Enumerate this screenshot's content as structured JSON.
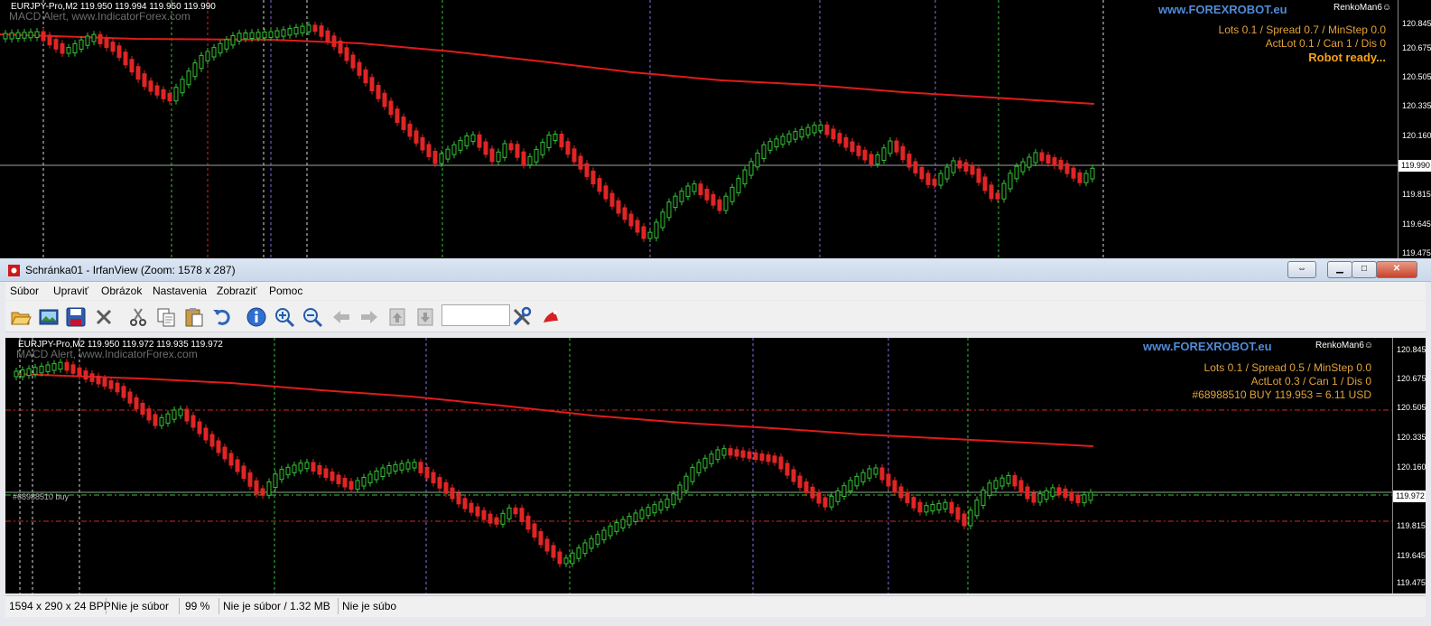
{
  "background_chart": {
    "symbol": "EURJPY-Pro,M2  119.950 119.994 119.950 119.990",
    "watermark": "MACD Alert, www.IndicatorForex.com",
    "brand": "www.FOREXROBOT.eu",
    "ea_name": "RenkoMan6☺",
    "info_line1": "Lots 0.1 / Spread 0.7 / MinStep 0.0",
    "info_line2": "ActLot 0.1 / Can 1 / Dis 0",
    "status": "Robot ready...",
    "price_ticks": [
      "120.845",
      "120.675",
      "120.505",
      "120.335",
      "120.160",
      "119.990",
      "119.815",
      "119.645",
      "119.475"
    ],
    "current_price": "119.990"
  },
  "window": {
    "title": "Schránka01 - IrfanView (Zoom: 1578 x 287)",
    "menu": [
      "Súbor",
      "Upraviť",
      "Obrázok",
      "Nastavenia",
      "Zobraziť",
      "Pomoc"
    ],
    "toolbar_icons": [
      "open-icon",
      "thumbnails-icon",
      "save-icon",
      "delete-icon",
      "cut-icon",
      "copy-icon",
      "paste-icon",
      "undo-icon",
      "info-icon",
      "zoom-in-icon",
      "zoom-out-icon",
      "previous-icon",
      "next-icon",
      "page-up-icon",
      "page-down-icon",
      "settings-icon",
      "irfanview-icon"
    ],
    "zoom_input": "",
    "status_bar": [
      "1594 x 290 x 24 BPP",
      "Nie je súbor",
      "99 %",
      "Nie je súbor / 1.32 MB",
      "Nie je súbo"
    ]
  },
  "inner_chart": {
    "symbol": "EURJPY-Pro,M2  119.950 119.972 119.935 119.972",
    "watermark": "MACD Alert, www.IndicatorForex.com",
    "brand": "www.FOREXROBOT.eu",
    "ea_name": "RenkoMan6☺",
    "info_line1": "Lots 0.1 / Spread 0.5 / MinStep 0.0",
    "info_line2": "ActLot 0.3 / Can 1 / Dis 0",
    "info_line3": "#68988510 BUY 119.953 = 6.11 USD",
    "order_label": "#68988510 buy",
    "price_ticks": [
      "120.845",
      "120.675",
      "120.505",
      "120.335",
      "120.160",
      "119.972",
      "119.815",
      "119.645",
      "119.475"
    ],
    "current_price": "119.972"
  },
  "colors": {
    "bull": "#35c335",
    "bear": "#e02525",
    "ma": "#e01b1b",
    "accent_blue": "#4f8bd8",
    "accent_orange": "#e3a23a"
  }
}
